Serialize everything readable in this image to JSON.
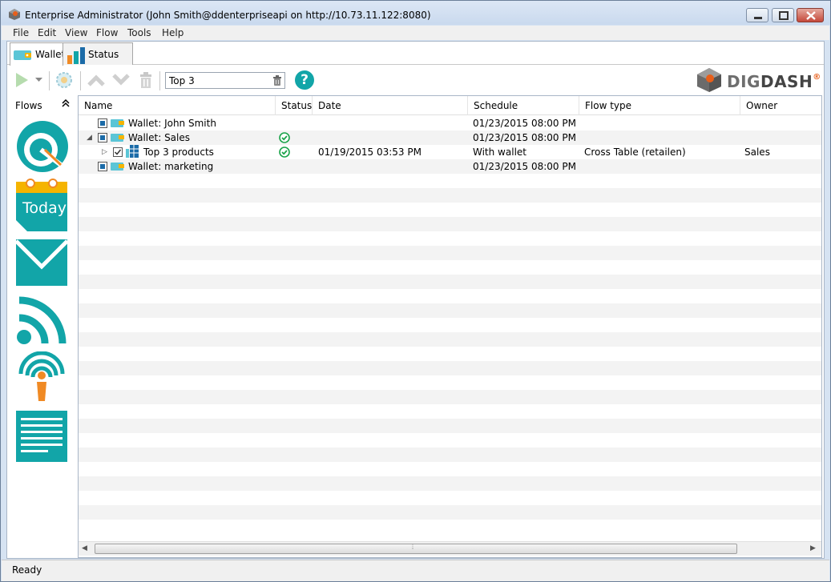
{
  "window": {
    "title": "Enterprise Administrator (John Smith@ddenterpriseapi on http://10.73.11.122:8080)"
  },
  "menu": {
    "items": [
      "File",
      "Edit",
      "View",
      "Flow",
      "Tools",
      "Help"
    ]
  },
  "tabs": [
    {
      "label": "Wallet",
      "active": true,
      "icon": "wallet-icon"
    },
    {
      "label": "Status",
      "active": false,
      "icon": "bar-chart-icon"
    }
  ],
  "toolbar": {
    "search_value": "Top 3",
    "help_label": "?",
    "icons": [
      "play-icon",
      "dropdown-arrow-icon",
      "settings-flower-icon",
      "move-up-icon",
      "move-down-icon",
      "trash-icon",
      "clear-search-icon",
      "help-icon"
    ]
  },
  "logo": {
    "dig": "DIG",
    "dash": "DASH",
    "accent": "®"
  },
  "sidebar": {
    "title": "Flows",
    "collapse_glyph": "⌃",
    "icons": [
      "dashboard-gauge-icon",
      "today-calendar-icon",
      "email-icon",
      "rss-feed-icon",
      "broadcast-icon",
      "document-list-icon"
    ],
    "today_label": "Today"
  },
  "table": {
    "columns": [
      "Name",
      "Status",
      "Date",
      "Schedule",
      "Flow type",
      "Owner"
    ],
    "rows": [
      {
        "name": "Wallet: John Smith",
        "status": "",
        "date": "",
        "schedule": "01/23/2015 08:00 PM",
        "flow_type": "",
        "owner": ""
      },
      {
        "name": "Wallet: Sales",
        "status": "ok",
        "date": "",
        "schedule": "01/23/2015 08:00 PM",
        "flow_type": "",
        "owner": ""
      },
      {
        "name": "Top 3 products",
        "status": "ok",
        "date": "01/19/2015 03:53 PM",
        "schedule": "With wallet",
        "flow_type": "Cross Table (retailen)",
        "owner": "Sales"
      },
      {
        "name": "Wallet: marketing",
        "status": "",
        "date": "",
        "schedule": "01/23/2015 08:00 PM",
        "flow_type": "",
        "owner": ""
      }
    ]
  },
  "statusbar": {
    "text": "Ready"
  },
  "colors": {
    "teal": "#12a5a8",
    "orange": "#f08a24",
    "status_ok": "#1aa34a"
  }
}
